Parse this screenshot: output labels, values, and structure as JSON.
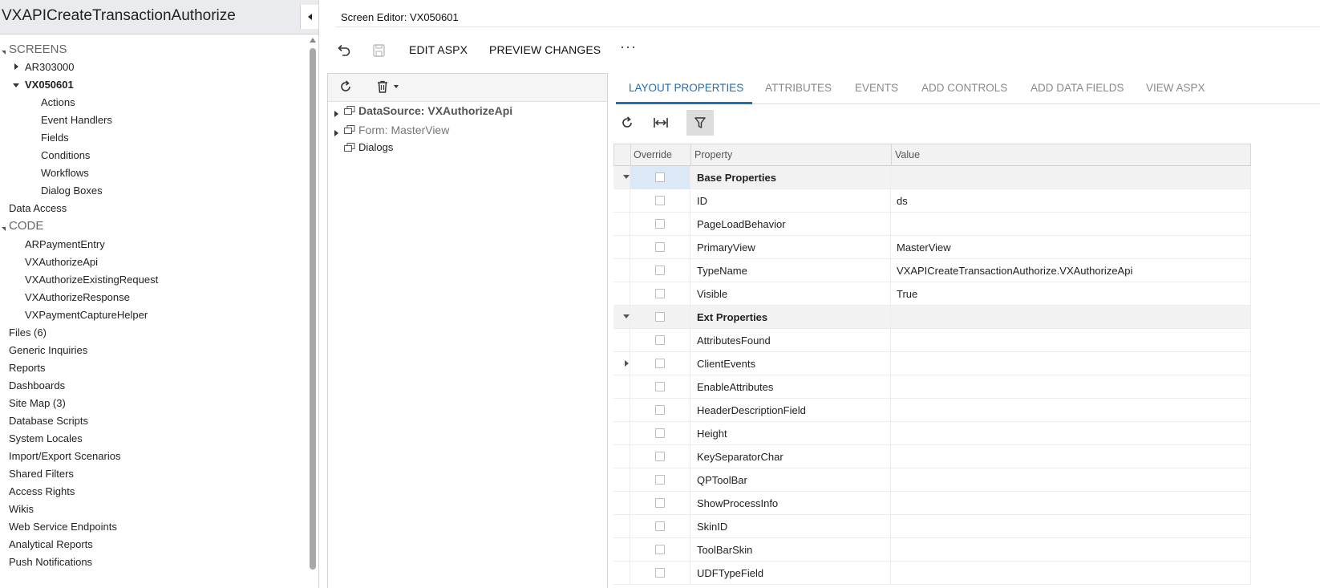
{
  "project": {
    "title": "VXAPICreateTransactionAuthorize"
  },
  "nav": {
    "screens_label": "SCREENS",
    "screens": [
      {
        "label": "AR303000"
      },
      {
        "label": "VX050601"
      }
    ],
    "screen_children": [
      "Actions",
      "Event Handlers",
      "Fields",
      "Conditions",
      "Workflows",
      "Dialog Boxes"
    ],
    "data_access": "Data Access",
    "code_label": "CODE",
    "code_items": [
      "ARPaymentEntry",
      "VXAuthorizeApi",
      "VXAuthorizeExistingRequest",
      "VXAuthorizeResponse",
      "VXPaymentCaptureHelper"
    ],
    "other_items": [
      "Files (6)",
      "Generic Inquiries",
      "Reports",
      "Dashboards",
      "Site Map (3)",
      "Database Scripts",
      "System Locales",
      "Import/Export Scenarios",
      "Shared Filters",
      "Access Rights",
      "Wikis",
      "Web Service Endpoints",
      "Analytical Reports",
      "Push Notifications"
    ]
  },
  "editor": {
    "title": "Screen Editor: VX050601",
    "toolbar": {
      "edit_aspx": "EDIT ASPX",
      "preview_changes": "PREVIEW CHANGES",
      "more": "···"
    },
    "objects": [
      {
        "prefix": "DataSource: ",
        "name": "VXAuthorizeApi"
      },
      {
        "prefix": "Form: ",
        "name": "MasterView"
      },
      {
        "prefix": "",
        "name": "Dialogs"
      }
    ],
    "tabs": [
      "LAYOUT PROPERTIES",
      "ATTRIBUTES",
      "EVENTS",
      "ADD CONTROLS",
      "ADD DATA FIELDS",
      "VIEW ASPX"
    ],
    "active_tab": "LAYOUT PROPERTIES"
  },
  "grid": {
    "columns": {
      "override": "Override",
      "property": "Property",
      "value": "Value"
    },
    "rows": [
      {
        "type": "group",
        "property": "Base Properties",
        "value": ""
      },
      {
        "type": "row",
        "property": "ID",
        "value": "ds"
      },
      {
        "type": "row",
        "property": "PageLoadBehavior",
        "value": ""
      },
      {
        "type": "row",
        "property": "PrimaryView",
        "value": "MasterView"
      },
      {
        "type": "row",
        "property": "TypeName",
        "value": "VXAPICreateTransactionAuthorize.VXAuthorizeApi"
      },
      {
        "type": "row",
        "property": "Visible",
        "value": "True"
      },
      {
        "type": "group",
        "property": "Ext Properties",
        "value": ""
      },
      {
        "type": "row",
        "property": "AttributesFound",
        "value": ""
      },
      {
        "type": "expandable",
        "property": "ClientEvents",
        "value": ""
      },
      {
        "type": "row",
        "property": "EnableAttributes",
        "value": ""
      },
      {
        "type": "row",
        "property": "HeaderDescriptionField",
        "value": ""
      },
      {
        "type": "row",
        "property": "Height",
        "value": ""
      },
      {
        "type": "row",
        "property": "KeySeparatorChar",
        "value": ""
      },
      {
        "type": "row",
        "property": "QPToolBar",
        "value": ""
      },
      {
        "type": "row",
        "property": "ShowProcessInfo",
        "value": ""
      },
      {
        "type": "row",
        "property": "SkinID",
        "value": ""
      },
      {
        "type": "row",
        "property": "ToolBarSkin",
        "value": ""
      },
      {
        "type": "row",
        "property": "UDFTypeField",
        "value": ""
      }
    ]
  },
  "colors": {
    "accent": "#1f6fb5",
    "header_bg": "#e9ebee",
    "selected": "#dbe9f7"
  }
}
